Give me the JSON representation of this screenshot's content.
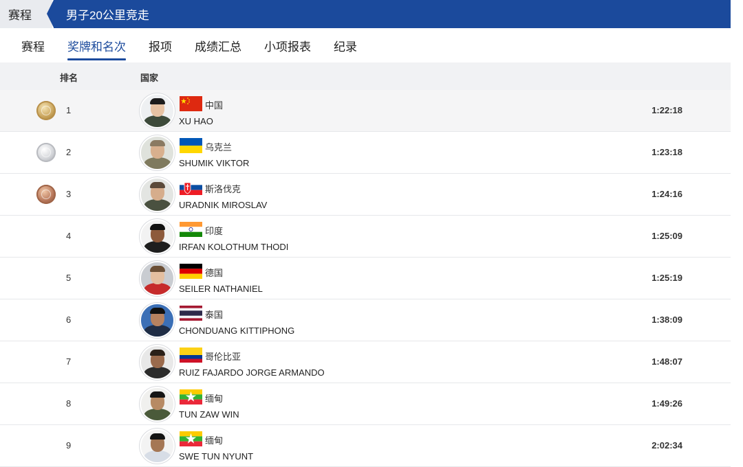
{
  "breadcrumb": {
    "home": "赛程",
    "current": "男子20公里竞走"
  },
  "tabs": [
    {
      "label": "赛程",
      "active": false
    },
    {
      "label": "奖牌和名次",
      "active": true
    },
    {
      "label": "报项",
      "active": false
    },
    {
      "label": "成绩汇总",
      "active": false
    },
    {
      "label": "小项报表",
      "active": false
    },
    {
      "label": "纪录",
      "active": false
    }
  ],
  "table": {
    "headers": {
      "rank": "排名",
      "country": "国家"
    },
    "rows": [
      {
        "rank": "1",
        "medal": "gold",
        "country": "中国",
        "flag": "china-flag",
        "name": "XU HAO",
        "time": "1:22:18"
      },
      {
        "rank": "2",
        "medal": "silver",
        "country": "乌克兰",
        "flag": "ukraine-flag",
        "name": "SHUMIK VIKTOR",
        "time": "1:23:18"
      },
      {
        "rank": "3",
        "medal": "bronze",
        "country": "斯洛伐克",
        "flag": "slovakia-flag",
        "name": "URADNIK MIROSLAV",
        "time": "1:24:16"
      },
      {
        "rank": "4",
        "medal": "",
        "country": "印度",
        "flag": "india-flag",
        "name": "IRFAN KOLOTHUM THODI",
        "time": "1:25:09"
      },
      {
        "rank": "5",
        "medal": "",
        "country": "德国",
        "flag": "germany-flag",
        "name": "SEILER NATHANIEL",
        "time": "1:25:19"
      },
      {
        "rank": "6",
        "medal": "",
        "country": "泰国",
        "flag": "thailand-flag",
        "name": "CHONDUANG KITTIPHONG",
        "time": "1:38:09"
      },
      {
        "rank": "7",
        "medal": "",
        "country": "哥伦比亚",
        "flag": "colombia-flag",
        "name": "RUIZ FAJARDO JORGE ARMANDO",
        "time": "1:48:07"
      },
      {
        "rank": "8",
        "medal": "",
        "country": "缅甸",
        "flag": "myanmar-flag",
        "name": "TUN ZAW WIN",
        "time": "1:49:26"
      },
      {
        "rank": "9",
        "medal": "",
        "country": "缅甸",
        "flag": "myanmar-flag",
        "name": "SWE TUN NYUNT",
        "time": "2:02:34"
      }
    ]
  },
  "colors": {
    "accent": "#1b4a9c",
    "header_bg": "#f1f2f4",
    "crumb_bg": "#e9ebef"
  }
}
